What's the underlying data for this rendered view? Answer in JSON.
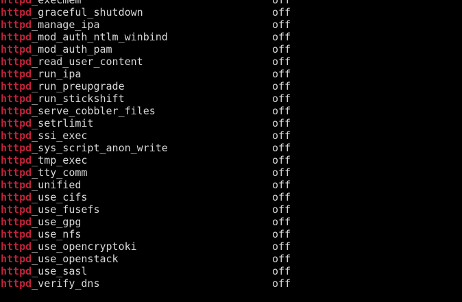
{
  "terminal": {
    "highlight_color": "#c2233a",
    "text_color": "#d8d8d8",
    "background": "#000000",
    "rows": [
      {
        "prefix": "httpd",
        "suffix": "_execmem",
        "state": "off"
      },
      {
        "prefix": "httpd",
        "suffix": "_graceful_shutdown",
        "state": "off"
      },
      {
        "prefix": "httpd",
        "suffix": "_manage_ipa",
        "state": "off"
      },
      {
        "prefix": "httpd",
        "suffix": "_mod_auth_ntlm_winbind",
        "state": "off"
      },
      {
        "prefix": "httpd",
        "suffix": "_mod_auth_pam",
        "state": "off"
      },
      {
        "prefix": "httpd",
        "suffix": "_read_user_content",
        "state": "off"
      },
      {
        "prefix": "httpd",
        "suffix": "_run_ipa",
        "state": "off"
      },
      {
        "prefix": "httpd",
        "suffix": "_run_preupgrade",
        "state": "off"
      },
      {
        "prefix": "httpd",
        "suffix": "_run_stickshift",
        "state": "off"
      },
      {
        "prefix": "httpd",
        "suffix": "_serve_cobbler_files",
        "state": "off"
      },
      {
        "prefix": "httpd",
        "suffix": "_setrlimit",
        "state": "off"
      },
      {
        "prefix": "httpd",
        "suffix": "_ssi_exec",
        "state": "off"
      },
      {
        "prefix": "httpd",
        "suffix": "_sys_script_anon_write",
        "state": "off"
      },
      {
        "prefix": "httpd",
        "suffix": "_tmp_exec",
        "state": "off"
      },
      {
        "prefix": "httpd",
        "suffix": "_tty_comm",
        "state": "off"
      },
      {
        "prefix": "httpd",
        "suffix": "_unified",
        "state": "off"
      },
      {
        "prefix": "httpd",
        "suffix": "_use_cifs",
        "state": "off"
      },
      {
        "prefix": "httpd",
        "suffix": "_use_fusefs",
        "state": "off"
      },
      {
        "prefix": "httpd",
        "suffix": "_use_gpg",
        "state": "off"
      },
      {
        "prefix": "httpd",
        "suffix": "_use_nfs",
        "state": "off"
      },
      {
        "prefix": "httpd",
        "suffix": "_use_opencryptoki",
        "state": "off"
      },
      {
        "prefix": "httpd",
        "suffix": "_use_openstack",
        "state": "off"
      },
      {
        "prefix": "httpd",
        "suffix": "_use_sasl",
        "state": "off"
      },
      {
        "prefix": "httpd",
        "suffix": "_verify_dns",
        "state": "off"
      }
    ]
  }
}
